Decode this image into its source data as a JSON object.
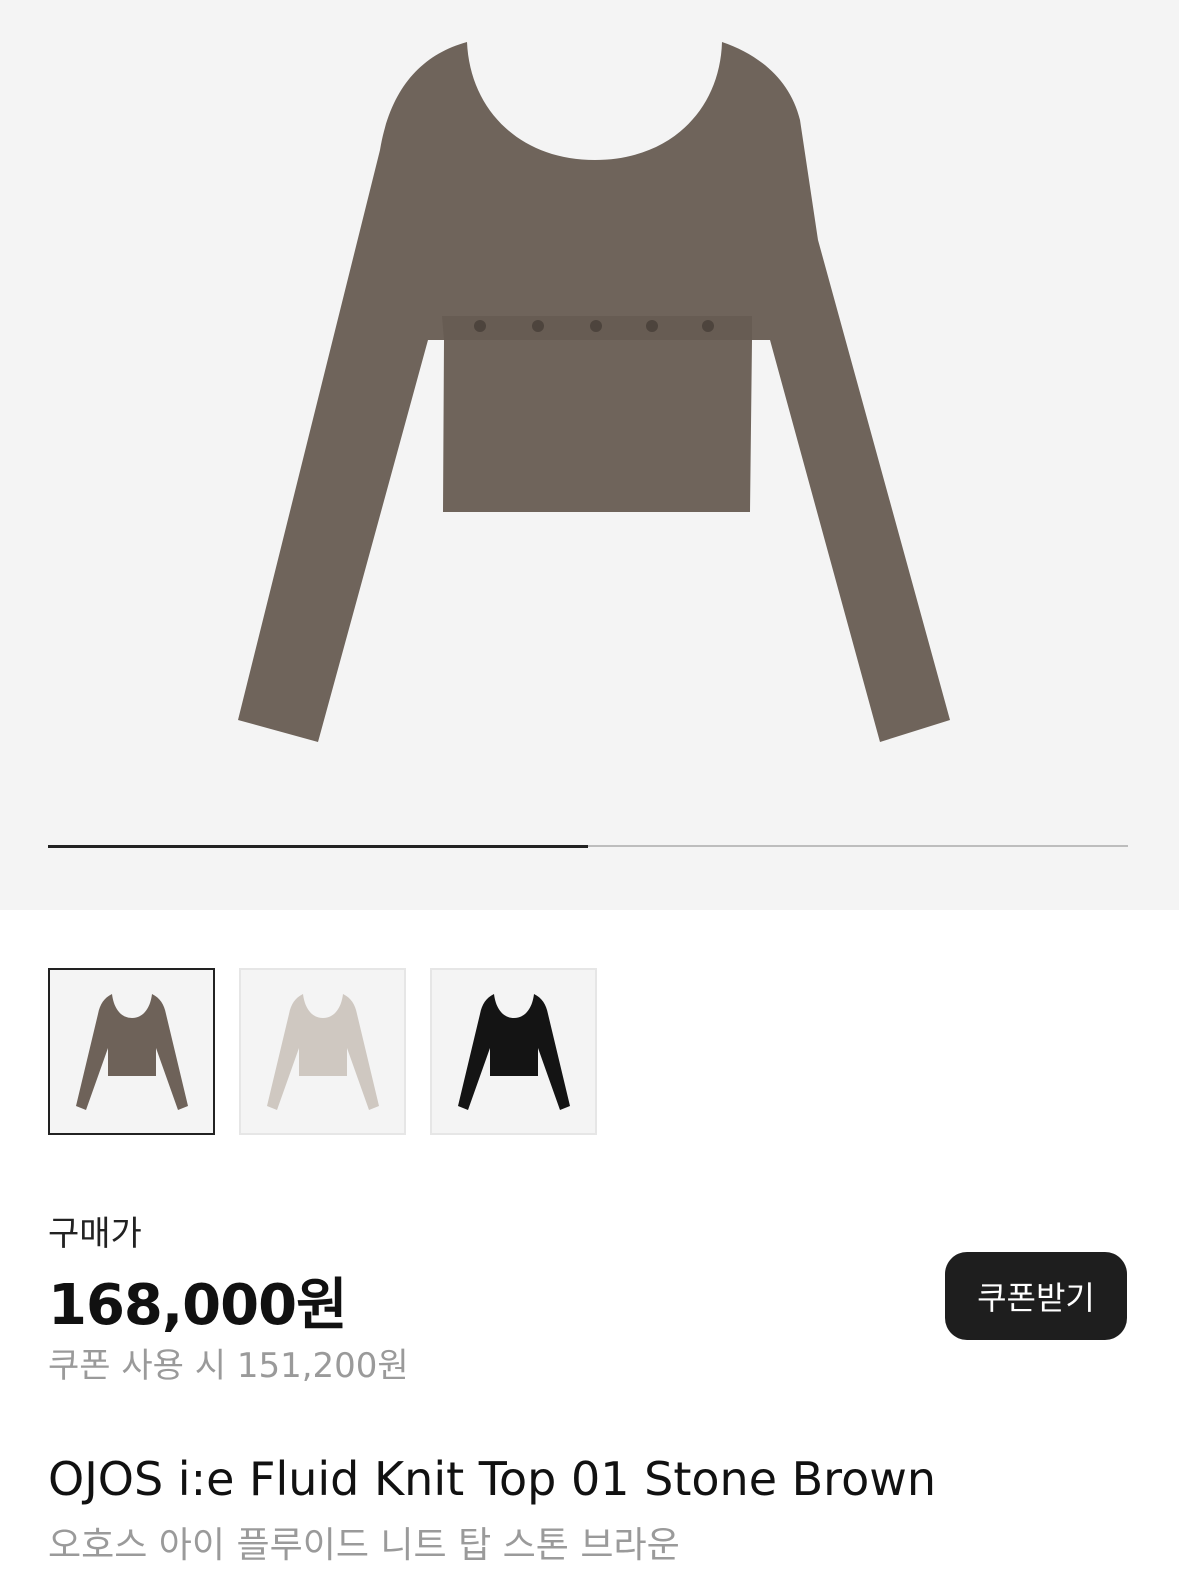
{
  "product": {
    "price_label": "구매가",
    "price": "168,000원",
    "coupon_price": "쿠폰 사용 시 151,200원",
    "coupon_button": "쿠폰받기",
    "title_en": "OJOS i:e Fluid Knit Top 01 Stone Brown",
    "title_ko": "오호스 아이 플루이드 니트 탑 스톤 브라운"
  },
  "gallery": {
    "progress": 0.5,
    "thumbnails": [
      {
        "color": "#6e6259",
        "selected": true
      },
      {
        "color": "#cfc8c1",
        "selected": false
      },
      {
        "color": "#141414",
        "selected": false
      }
    ]
  },
  "colors": {
    "main_garment": "#6f645b",
    "button_bg": "#1e1e1e",
    "muted_text": "#9a9a9a",
    "hero_bg": "#f4f4f4"
  }
}
